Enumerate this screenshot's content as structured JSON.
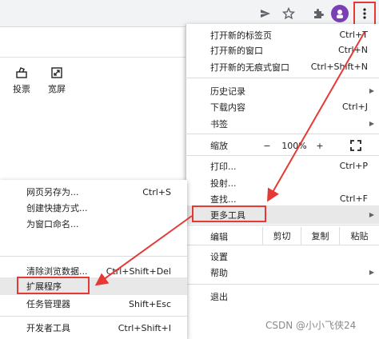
{
  "toolbar": {
    "icons": [
      "share-icon",
      "star-icon",
      "extensions-icon",
      "profile-avatar",
      "kebab-menu-icon"
    ]
  },
  "page": {
    "tools": [
      {
        "label": "投票",
        "icon": "vote-icon"
      },
      {
        "label": "宽屏",
        "icon": "widescreen-icon"
      }
    ]
  },
  "menu": {
    "new_tab": {
      "label": "打开新的标签页",
      "shortcut": "Ctrl+T"
    },
    "new_window": {
      "label": "打开新的窗口",
      "shortcut": "Ctrl+N"
    },
    "new_incognito": {
      "label": "打开新的无痕式窗口",
      "shortcut": "Ctrl+Shift+N"
    },
    "history": {
      "label": "历史记录"
    },
    "downloads": {
      "label": "下载内容",
      "shortcut": "Ctrl+J"
    },
    "bookmarks": {
      "label": "书签"
    },
    "zoom": {
      "label": "缩放",
      "minus": "−",
      "value": "100%",
      "plus": "+"
    },
    "print": {
      "label": "打印...",
      "shortcut": "Ctrl+P"
    },
    "cast": {
      "label": "投射..."
    },
    "find": {
      "label": "查找...",
      "shortcut": "Ctrl+F"
    },
    "more_tools": {
      "label": "更多工具"
    },
    "edit": {
      "label": "编辑",
      "cut": "剪切",
      "copy": "复制",
      "paste": "粘贴"
    },
    "settings": {
      "label": "设置"
    },
    "help": {
      "label": "帮助"
    },
    "exit": {
      "label": "退出"
    }
  },
  "submenu": {
    "save_page": {
      "label": "网页另存为...",
      "shortcut": "Ctrl+S"
    },
    "create_shortcut": {
      "label": "创建快捷方式..."
    },
    "name_window": {
      "label": "为窗口命名..."
    },
    "clear_data": {
      "label": "清除浏览数据...",
      "shortcut": "Ctrl+Shift+Del"
    },
    "extensions": {
      "label": "扩展程序"
    },
    "task_manager": {
      "label": "任务管理器",
      "shortcut": "Shift+Esc"
    },
    "dev_tools": {
      "label": "开发者工具",
      "shortcut": "Ctrl+Shift+I"
    }
  },
  "watermark": "CSDN @小小飞侠24",
  "colors": {
    "highlight_border": "#e53935",
    "hover_bg": "#e8e8e8",
    "avatar": "#7b3fb5"
  }
}
